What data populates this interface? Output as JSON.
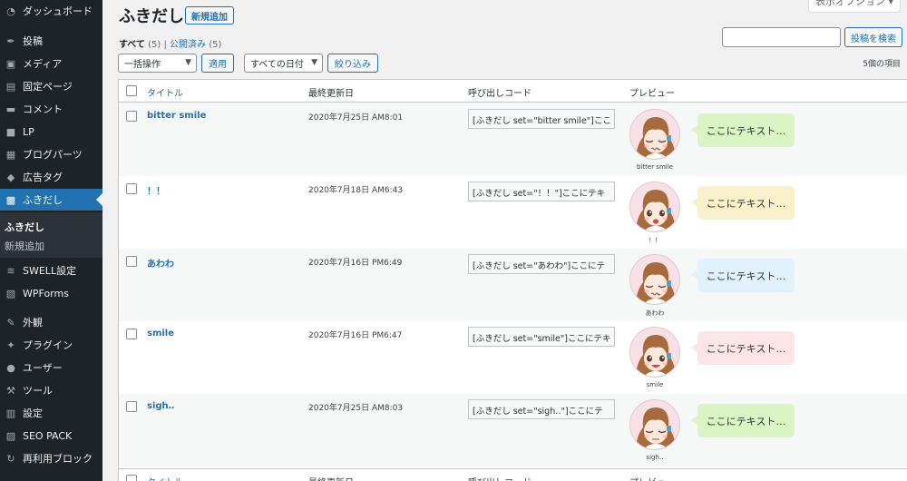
{
  "sidebar": {
    "items": [
      {
        "label": "ダッシュボード",
        "icon": "dashboard-icon"
      },
      {
        "label": "投稿",
        "icon": "pin-icon"
      },
      {
        "label": "メディア",
        "icon": "media-icon"
      },
      {
        "label": "固定ページ",
        "icon": "page-icon"
      },
      {
        "label": "コメント",
        "icon": "comment-icon"
      },
      {
        "label": "LP",
        "icon": "lp-icon"
      },
      {
        "label": "ブログパーツ",
        "icon": "blog-parts-icon"
      },
      {
        "label": "広告タグ",
        "icon": "tag-icon"
      },
      {
        "label": "ふきだし",
        "icon": "speech-bubble-icon"
      },
      {
        "label": "SWELL設定",
        "icon": "swell-icon"
      },
      {
        "label": "WPForms",
        "icon": "forms-icon"
      },
      {
        "label": "外観",
        "icon": "appearance-icon"
      },
      {
        "label": "プラグイン",
        "icon": "plugin-icon"
      },
      {
        "label": "ユーザー",
        "icon": "user-icon"
      },
      {
        "label": "ツール",
        "icon": "tool-icon"
      },
      {
        "label": "設定",
        "icon": "settings-icon"
      },
      {
        "label": "SEO PACK",
        "icon": "seo-icon"
      },
      {
        "label": "再利用ブロック",
        "icon": "reuse-icon"
      }
    ],
    "submenu": [
      "ふきだし",
      "新規追加"
    ]
  },
  "header": {
    "screen_options": "表示オプション ▾",
    "title": "ふきだし",
    "add_new": "新規追加"
  },
  "filters": {
    "all_label": "すべて",
    "all_count": "(5)",
    "separator": "|",
    "published_label": "公開済み",
    "published_count": "(5)",
    "bulk_action": "一括操作",
    "apply": "適用",
    "date_filter": "すべての日付",
    "filter_btn": "絞り込み",
    "items_count": "5個の項目",
    "search_btn": "投稿を検索",
    "search_value": ""
  },
  "table": {
    "columns": [
      "タイトル",
      "最終更新日",
      "呼び出しコード",
      "プレビュー"
    ],
    "rows": [
      {
        "title": "bitter smile",
        "date": "2020年7月25日 AM8:01",
        "code": "[ふきだし set=\"bitter smile\"]ここ",
        "name": "bitter smile",
        "balloon": "ここにテキスト…",
        "balloon_color": "#d9f5c4",
        "mouth": "wavy",
        "eyes": "closed"
      },
      {
        "title": "！！",
        "date": "2020年7月18日 AM6:43",
        "code": "[ふきだし set=\"！！\"]ここにテキ",
        "name": "！！",
        "balloon": "ここにテキスト…",
        "balloon_color": "#f8f1c9",
        "mouth": "open",
        "eyes": "open"
      },
      {
        "title": "あわわ",
        "date": "2020年7月16日 PM6:49",
        "code": "[ふきだし set=\"あわわ\"]ここにテ",
        "name": "あわわ",
        "balloon": "ここにテキスト…",
        "balloon_color": "#e2f2fc",
        "mouth": "wavy",
        "eyes": "closed"
      },
      {
        "title": "smile",
        "date": "2020年7月16日 PM6:47",
        "code": "[ふきだし set=\"smile\"]ここにテキ",
        "name": "smile",
        "balloon": "ここにテキスト…",
        "balloon_color": "#fde5e7",
        "mouth": "smile",
        "eyes": "open"
      },
      {
        "title": "sigh‥",
        "date": "2020年7月25日 AM8:03",
        "code": "[ふきだし set=\"sigh‥\"]ここにテ",
        "name": "sigh‥",
        "balloon": "ここにテキスト…",
        "balloon_color": "#d9f5c4",
        "mouth": "flat",
        "eyes": "closed"
      }
    ]
  },
  "colors": {
    "sidebar_bg": "#1d2327",
    "accent": "#2271b1"
  }
}
